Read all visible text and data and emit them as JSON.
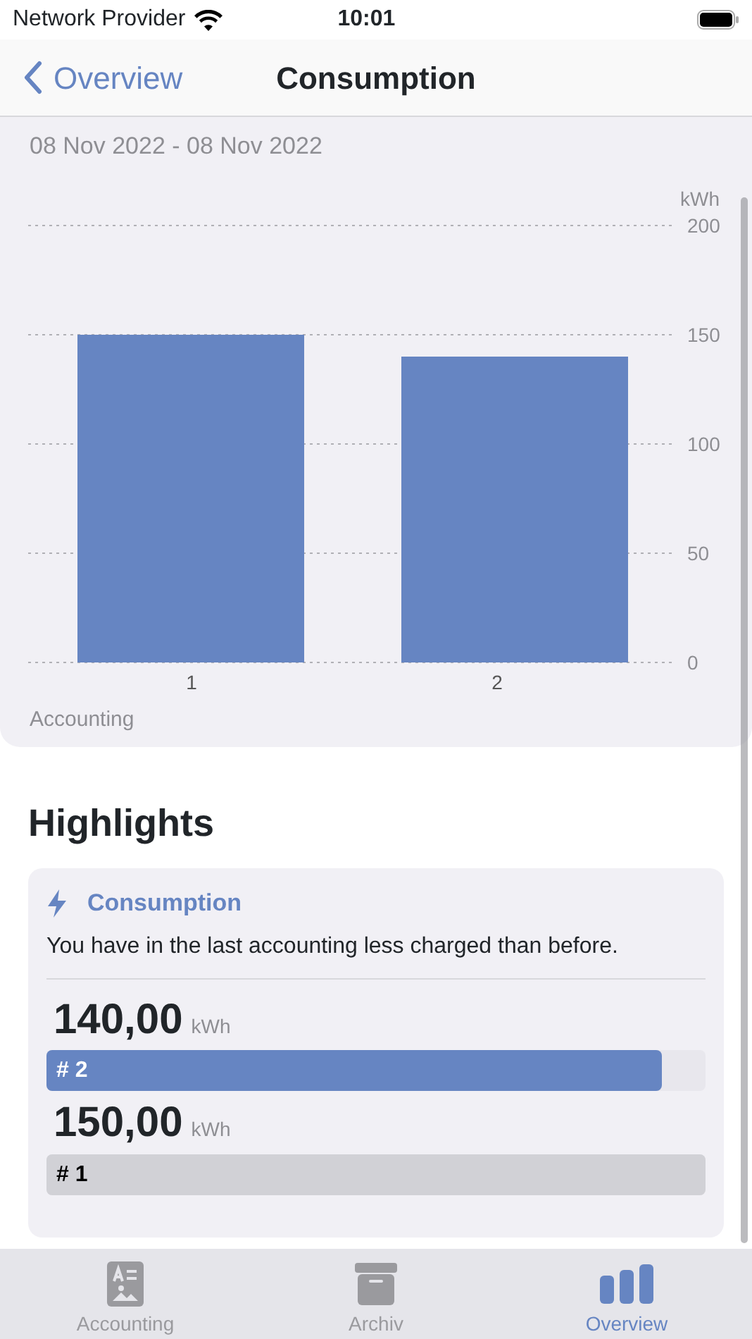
{
  "status_bar": {
    "carrier": "Network Provider",
    "time": "10:01"
  },
  "nav": {
    "back": "Overview",
    "title": "Consumption"
  },
  "period": "08 Nov 2022 - 08 Nov 2022",
  "chart_data": {
    "type": "bar",
    "xlabel": "Accounting",
    "ylabel": "kWh",
    "categories": [
      "1",
      "2"
    ],
    "series": [
      {
        "color": "#6685c2",
        "values": [
          150,
          140
        ]
      }
    ],
    "grid": true,
    "ylim": [
      0,
      200
    ],
    "yticks": [
      0,
      50,
      100,
      150,
      200
    ]
  },
  "highlights": {
    "title": "Highlights",
    "card": {
      "title": "Consumption",
      "text": "You have in the last accounting less charged than before.",
      "entries": [
        {
          "value": "140,00",
          "unit": "kWh",
          "label": "# 2",
          "level": 0.933,
          "color": "#6685c2"
        },
        {
          "value": "150,00",
          "unit": "kWh",
          "label": "# 1",
          "level": 1,
          "color": "#d1d1d6"
        }
      ]
    }
  },
  "tabs": [
    {
      "label": "Accounting",
      "selected": false
    },
    {
      "label": "Archiv",
      "selected": false
    },
    {
      "label": "Overview",
      "selected": true
    }
  ]
}
